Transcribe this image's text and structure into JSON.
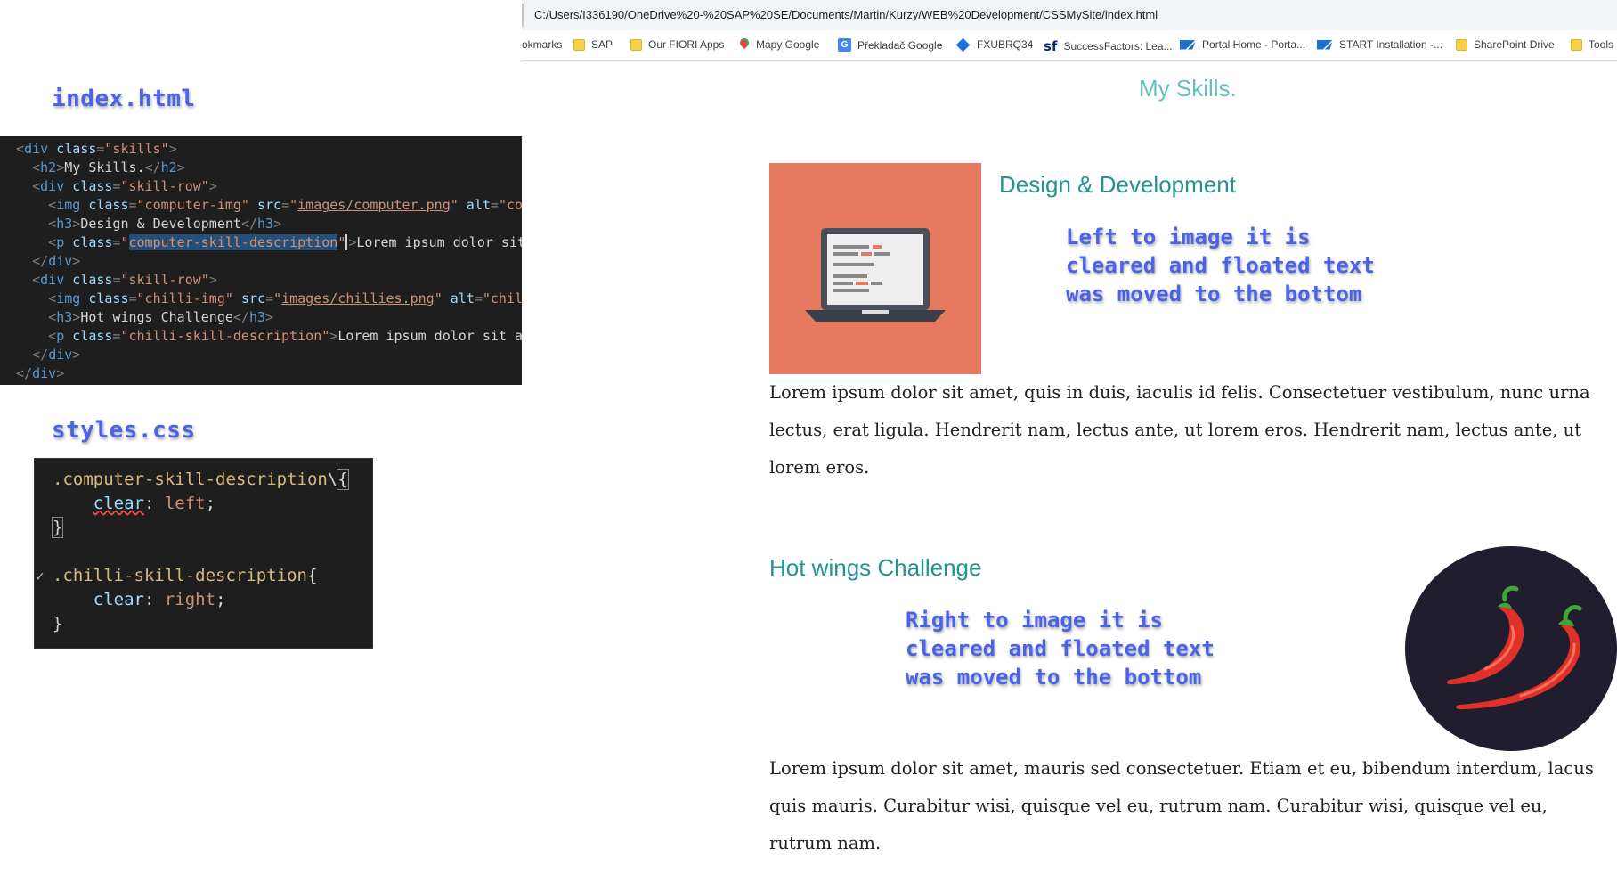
{
  "annotations": {
    "html_file": "index.html",
    "css_file": "styles.css",
    "left_note": [
      "Left to image it is",
      "cleared and floated text",
      "was moved to the bottom"
    ],
    "right_note": [
      "Right to image it is",
      "cleared and floated text",
      "was moved to the bottom"
    ]
  },
  "html_code": {
    "lines": [
      [
        [
          "punc",
          "  <"
        ],
        [
          "tag",
          "div"
        ],
        [
          "attr",
          " class"
        ],
        [
          "punc",
          "="
        ],
        [
          "str",
          "\"skills\""
        ],
        [
          "punc",
          ">"
        ]
      ],
      [
        [
          "punc",
          "    <"
        ],
        [
          "tag",
          "h2"
        ],
        [
          "punc",
          ">"
        ],
        [
          "text",
          "My Skills."
        ],
        [
          "punc",
          "</"
        ],
        [
          "tag",
          "h2"
        ],
        [
          "punc",
          ">"
        ]
      ],
      [
        [
          "punc",
          "    <"
        ],
        [
          "tag",
          "div"
        ],
        [
          "attr",
          " class"
        ],
        [
          "punc",
          "="
        ],
        [
          "str",
          "\"skill-row\""
        ],
        [
          "punc",
          ">"
        ]
      ],
      [
        [
          "punc",
          "      <"
        ],
        [
          "tag",
          "img"
        ],
        [
          "attr",
          " class"
        ],
        [
          "punc",
          "="
        ],
        [
          "str",
          "\"computer-img\""
        ],
        [
          "attr",
          " src"
        ],
        [
          "punc",
          "="
        ],
        [
          "str",
          "\""
        ],
        [
          "link",
          "images/computer.png"
        ],
        [
          "str",
          "\""
        ],
        [
          "attr",
          " alt"
        ],
        [
          "punc",
          "="
        ],
        [
          "str",
          "\"computer-img\""
        ],
        [
          "punc",
          ">"
        ]
      ],
      [
        [
          "punc",
          "      <"
        ],
        [
          "tag",
          "h3"
        ],
        [
          "punc",
          ">"
        ],
        [
          "text",
          "Design & Development"
        ],
        [
          "punc",
          "</"
        ],
        [
          "tag",
          "h3"
        ],
        [
          "punc",
          ">"
        ]
      ],
      [
        [
          "punc",
          "      <"
        ],
        [
          "tag",
          "p"
        ],
        [
          "attr",
          " class"
        ],
        [
          "punc",
          "="
        ],
        [
          "str",
          "\""
        ],
        [
          "sel",
          "computer-skill-description"
        ],
        [
          "cursor",
          "\""
        ],
        [
          "punc",
          ">"
        ],
        [
          "text",
          "Lorem ipsum dolor sit amet, quis in duis, iaculi"
        ]
      ],
      [
        [
          "punc",
          "    </"
        ],
        [
          "tag",
          "div"
        ],
        [
          "punc",
          ">"
        ]
      ],
      [
        [
          "punc",
          "    <"
        ],
        [
          "tag",
          "div"
        ],
        [
          "attr",
          " class"
        ],
        [
          "punc",
          "="
        ],
        [
          "str",
          "\"skill-row\""
        ],
        [
          "punc",
          ">"
        ]
      ],
      [
        [
          "punc",
          "      <"
        ],
        [
          "tag",
          "img"
        ],
        [
          "attr",
          " class"
        ],
        [
          "punc",
          "="
        ],
        [
          "str",
          "\"chilli-img\""
        ],
        [
          "attr",
          " src"
        ],
        [
          "punc",
          "="
        ],
        [
          "str",
          "\""
        ],
        [
          "link",
          "images/chillies.png"
        ],
        [
          "str",
          "\""
        ],
        [
          "attr",
          " alt"
        ],
        [
          "punc",
          "="
        ],
        [
          "str",
          "\"chillies-img\""
        ],
        [
          "punc",
          ">"
        ]
      ],
      [
        [
          "punc",
          "      <"
        ],
        [
          "tag",
          "h3"
        ],
        [
          "punc",
          ">"
        ],
        [
          "text",
          "Hot wings Challenge"
        ],
        [
          "punc",
          "</"
        ],
        [
          "tag",
          "h3"
        ],
        [
          "punc",
          ">"
        ]
      ],
      [
        [
          "punc",
          "      <"
        ],
        [
          "tag",
          "p"
        ],
        [
          "attr",
          " class"
        ],
        [
          "punc",
          "="
        ],
        [
          "str",
          "\"chilli-skill-description\""
        ],
        [
          "punc",
          ">"
        ],
        [
          "text",
          "Lorem ipsum dolor sit amet, mauris sed consectetue"
        ]
      ],
      [
        [
          "punc",
          "    </"
        ],
        [
          "tag",
          "div"
        ],
        [
          "punc",
          ">"
        ]
      ],
      [
        [
          "punc",
          "  </"
        ],
        [
          "tag",
          "div"
        ],
        [
          "punc",
          ">"
        ]
      ]
    ]
  },
  "css_code": {
    "lines": [
      [
        [
          "selname",
          ".computer-skill-description"
        ],
        [
          "brace",
          "\\"
        ],
        [
          "bracebox",
          "{"
        ]
      ],
      [
        [
          "brace",
          "    "
        ],
        [
          "properr",
          "clear"
        ],
        [
          "brace",
          ": "
        ],
        [
          "val",
          "left"
        ],
        [
          "brace",
          ";"
        ]
      ],
      [
        [
          "bracebox",
          "}"
        ]
      ],
      [
        [
          "brace",
          " "
        ]
      ],
      [
        [
          "selname",
          ".chilli-skill-description"
        ],
        [
          "brace",
          "{"
        ]
      ],
      [
        [
          "brace",
          "    "
        ],
        [
          "prop",
          "clear"
        ],
        [
          "brace",
          ": "
        ],
        [
          "val",
          "right"
        ],
        [
          "brace",
          ";"
        ]
      ],
      [
        [
          "brace",
          "}"
        ]
      ]
    ],
    "caret_glyph": "✓"
  },
  "browser": {
    "url": "C:/Users/I336190/OneDrive%20-%20SAP%20SE/Documents/Martin/Kurzy/WEB%20Development/CSSMySite/index.html",
    "bookmarks": [
      {
        "label": "okmarks",
        "icon": "none"
      },
      {
        "label": "SAP",
        "icon": "folder-icon"
      },
      {
        "label": "Our FIORI Apps",
        "icon": "folder-icon"
      },
      {
        "label": "Mapy Google",
        "icon": "pin-icon"
      },
      {
        "label": "Překladač Google",
        "icon": "translate-icon"
      },
      {
        "label": "FXUBRQ34",
        "icon": "diamond-icon"
      },
      {
        "label": "SuccessFactors: Lea...",
        "icon": "sf-icon"
      },
      {
        "label": "Portal Home - Porta...",
        "icon": "sap-icon"
      },
      {
        "label": "START Installation -...",
        "icon": "sap-icon"
      },
      {
        "label": "SharePoint Drive",
        "icon": "folder-icon"
      },
      {
        "label": "Tools",
        "icon": "folder-icon"
      }
    ],
    "translate_glyph": "G",
    "sf_glyph": "sf"
  },
  "page": {
    "heading": "My Skills.",
    "skill1_title": "Design & Development",
    "skill1_desc": "Lorem ipsum dolor sit amet, quis in duis, iaculis id felis. Consectetuer vestibulum, nunc urna lectus, erat ligula. Hendrerit nam, lectus ante, ut lorem eros. Hendrerit nam, lectus ante, ut lorem eros.",
    "skill2_title": "Hot wings Challenge",
    "skill2_desc": "Lorem ipsum dolor sit amet, mauris sed consectetuer. Etiam et eu, bibendum interdum, lacus quis mauris. Curabitur wisi, quisque vel eu, rutrum nam. Curabitur wisi, quisque vel eu, rutrum nam."
  },
  "colors": {
    "annotation": "#4a63e8",
    "heading": "#66bfbf",
    "skill_title": "#229390",
    "computer_bg": "#e57a5f",
    "chilli_bg": "#1f1d2e",
    "editor_bg": "#1e1e1e"
  }
}
